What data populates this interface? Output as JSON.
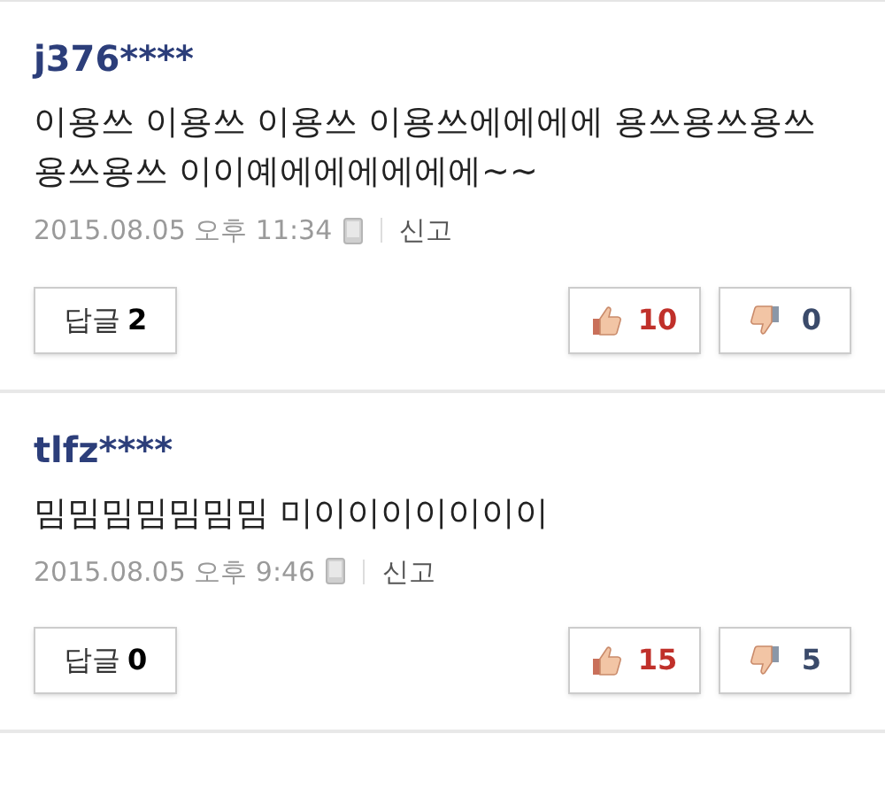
{
  "comments": [
    {
      "username": "j376****",
      "text": "이용쓰 이용쓰 이용쓰 이용쓰에에에에 용쓰용쓰용쓰용쓰용쓰 이이예에에에에에에~~",
      "date": "2015.08.05 오후 11:34",
      "report": "신고",
      "reply_label": "답글",
      "reply_count": "2",
      "likes": "10",
      "dislikes": "0"
    },
    {
      "username": "tlfz****",
      "text": "밈밈밈밈밈밈밈 미이이이이이이이",
      "date": "2015.08.05 오후 9:46",
      "report": "신고",
      "reply_label": "답글",
      "reply_count": "0",
      "likes": "15",
      "dislikes": "5"
    }
  ]
}
